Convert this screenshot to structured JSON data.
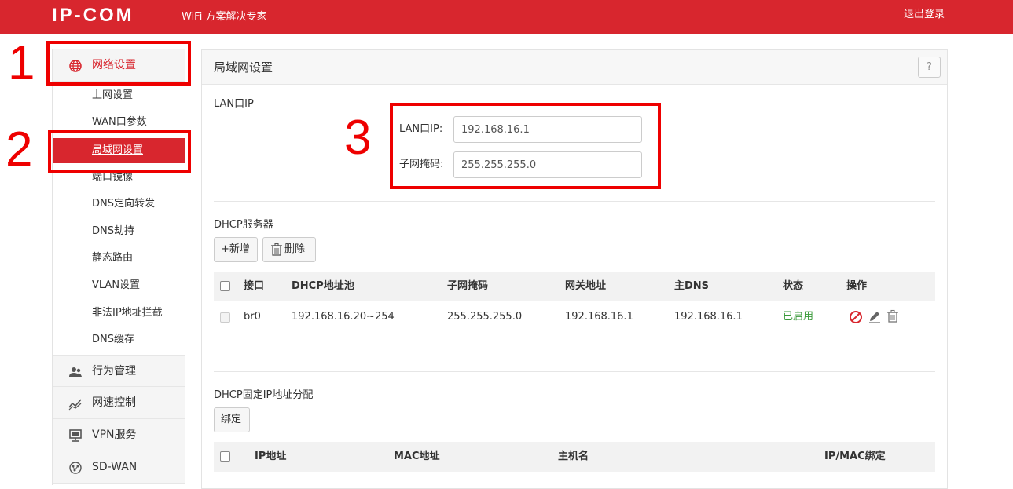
{
  "header": {
    "logo": "IP-COM",
    "tagline": "WiFi 方案解决专家",
    "logout": "退出登录"
  },
  "sidebar": {
    "network_settings": "网络设置",
    "sub_items": [
      "上网设置",
      "WAN口参数",
      "局域网设置",
      "端口镜像",
      "DNS定向转发",
      "DNS劫持",
      "静态路由",
      "VLAN设置",
      "非法IP地址拦截",
      "DNS缓存"
    ],
    "active_sub": "局域网设置",
    "groups": [
      "行为管理",
      "网速控制",
      "VPN服务",
      "SD-WAN"
    ]
  },
  "annotations": [
    "1",
    "2",
    "3"
  ],
  "panel": {
    "title": "局域网设置",
    "help": "?",
    "lan_section": "LAN口IP",
    "lan_ip_label": "LAN口IP:",
    "lan_ip_value": "192.168.16.1",
    "subnet_label": "子网掩码:",
    "subnet_value": "255.255.255.0",
    "dhcp_section": "DHCP服务器",
    "add_button": "+新增",
    "delete_button": "删除",
    "dhcp_table": {
      "headers": [
        "接口",
        "DHCP地址池",
        "子网掩码",
        "网关地址",
        "主DNS",
        "状态",
        "操作"
      ],
      "rows": [
        [
          "br0",
          "192.168.16.20~254",
          "255.255.255.0",
          "192.168.16.1",
          "192.168.16.1",
          "已启用"
        ]
      ]
    },
    "static_section": "DHCP固定IP地址分配",
    "bind_button": "绑定",
    "static_table": {
      "headers": [
        "IP地址",
        "MAC地址",
        "主机名",
        "IP/MAC绑定"
      ]
    }
  },
  "colors": {
    "brand_red": "#d8262e",
    "annotation_red": "#ee0000",
    "status_green": "#3a9a3a"
  }
}
